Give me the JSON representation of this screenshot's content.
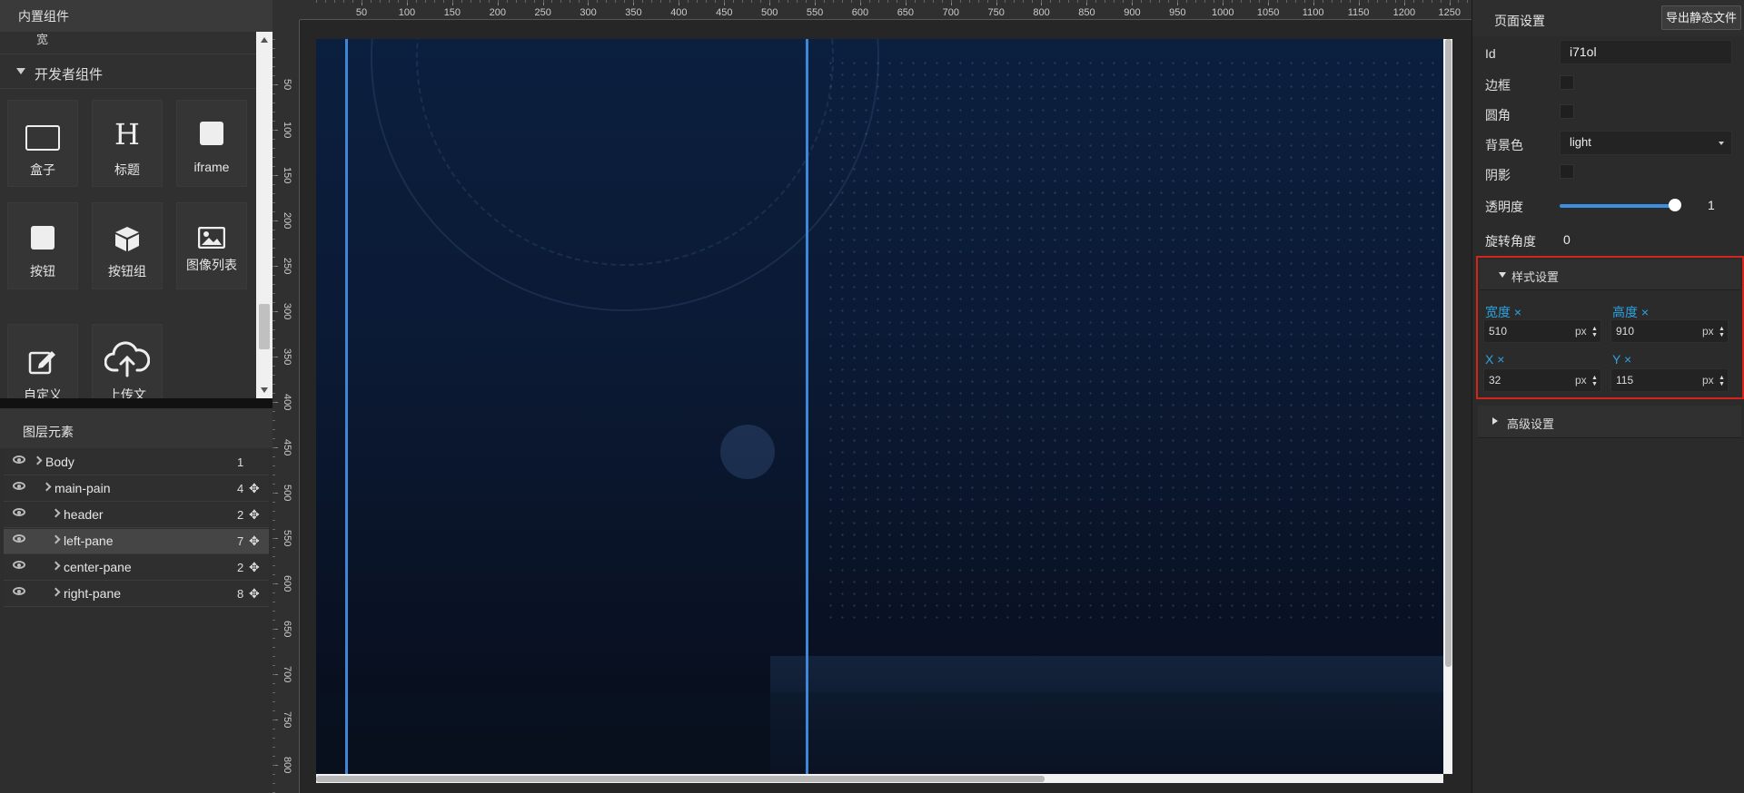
{
  "left_panel": {
    "header_title": "内置组件",
    "cut_item_label": "宽",
    "group_title": "开发者组件",
    "tiles": [
      {
        "label": "盒子",
        "icon": "box-icon"
      },
      {
        "label": "标题",
        "icon": "heading-icon"
      },
      {
        "label": "iframe",
        "icon": "iframe-icon"
      },
      {
        "label": "按钮",
        "icon": "button-icon"
      },
      {
        "label": "按钮组",
        "icon": "cube-icon"
      },
      {
        "label": "图像列表",
        "icon": "image-icon"
      },
      {
        "label": "自定义",
        "icon": "edit-icon"
      },
      {
        "label": "上传文",
        "icon": "cloud-upload-icon"
      }
    ]
  },
  "layers": {
    "header_title": "图层元素",
    "items": [
      {
        "name": "Body",
        "count": "1"
      },
      {
        "name": "main-pain",
        "count": "4"
      },
      {
        "name": "header",
        "count": "2"
      },
      {
        "name": "left-pane",
        "count": "7"
      },
      {
        "name": "center-pane",
        "count": "2"
      },
      {
        "name": "right-pane",
        "count": "8"
      }
    ]
  },
  "ruler": {
    "top_labels": [
      "50",
      "100",
      "150",
      "200",
      "250",
      "300",
      "350",
      "400",
      "450",
      "500",
      "550",
      "600",
      "650",
      "700",
      "750",
      "800",
      "850",
      "900",
      "950",
      "1000",
      "1050",
      "1100",
      "1150",
      "1200",
      "1250"
    ],
    "left_labels": [
      "50",
      "100",
      "150",
      "200",
      "250",
      "300",
      "350",
      "400",
      "450",
      "500",
      "550",
      "600",
      "650",
      "700",
      "750",
      "800"
    ]
  },
  "right_panel": {
    "title": "页面设置",
    "export_button": "导出静态文件",
    "id_label": "Id",
    "id_value": "i71ol",
    "border_label": "边框",
    "radius_label": "圆角",
    "bg_label": "背景色",
    "bg_value": "light",
    "shadow_label": "阴影",
    "opacity_label": "透明度",
    "opacity_value": "1",
    "rotation_label": "旋转角度",
    "rotation_value": "0",
    "style_section": {
      "title": "样式设置",
      "width_label": "宽度 ×",
      "width_value": "510",
      "height_label": "高度 ×",
      "height_value": "910",
      "x_label": "X ×",
      "x_value": "32",
      "y_label": "Y ×",
      "y_value": "115",
      "unit": "px"
    },
    "advanced_section": "高级设置"
  },
  "colors": {
    "accent": "#2ea2e0",
    "guide": "#3f86d6",
    "highlight_border": "#d8221c",
    "slider": "#3c8ee0"
  }
}
